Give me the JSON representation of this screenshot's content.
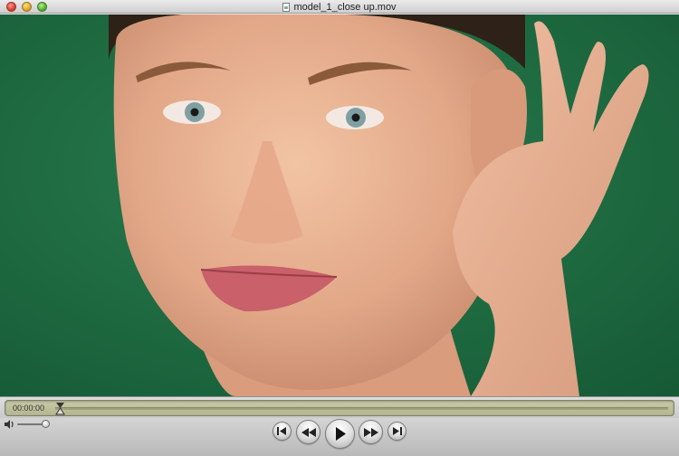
{
  "window": {
    "title": "model_1_close up.mov",
    "file_icon": "document-icon"
  },
  "video": {
    "subject": "video-frame",
    "background_color": "#1e6a42"
  },
  "scrubber": {
    "timecode": "00:00:00",
    "progress": 0.0
  },
  "controls": {
    "volume_icon": "speaker-icon",
    "volume_level": 0.85,
    "buttons": [
      {
        "name": "go-to-start",
        "icon": "skip-back-icon"
      },
      {
        "name": "rewind",
        "icon": "rewind-icon"
      },
      {
        "name": "play",
        "icon": "play-icon"
      },
      {
        "name": "fast-forward",
        "icon": "fast-forward-icon"
      },
      {
        "name": "go-to-end",
        "icon": "skip-forward-icon"
      }
    ]
  }
}
